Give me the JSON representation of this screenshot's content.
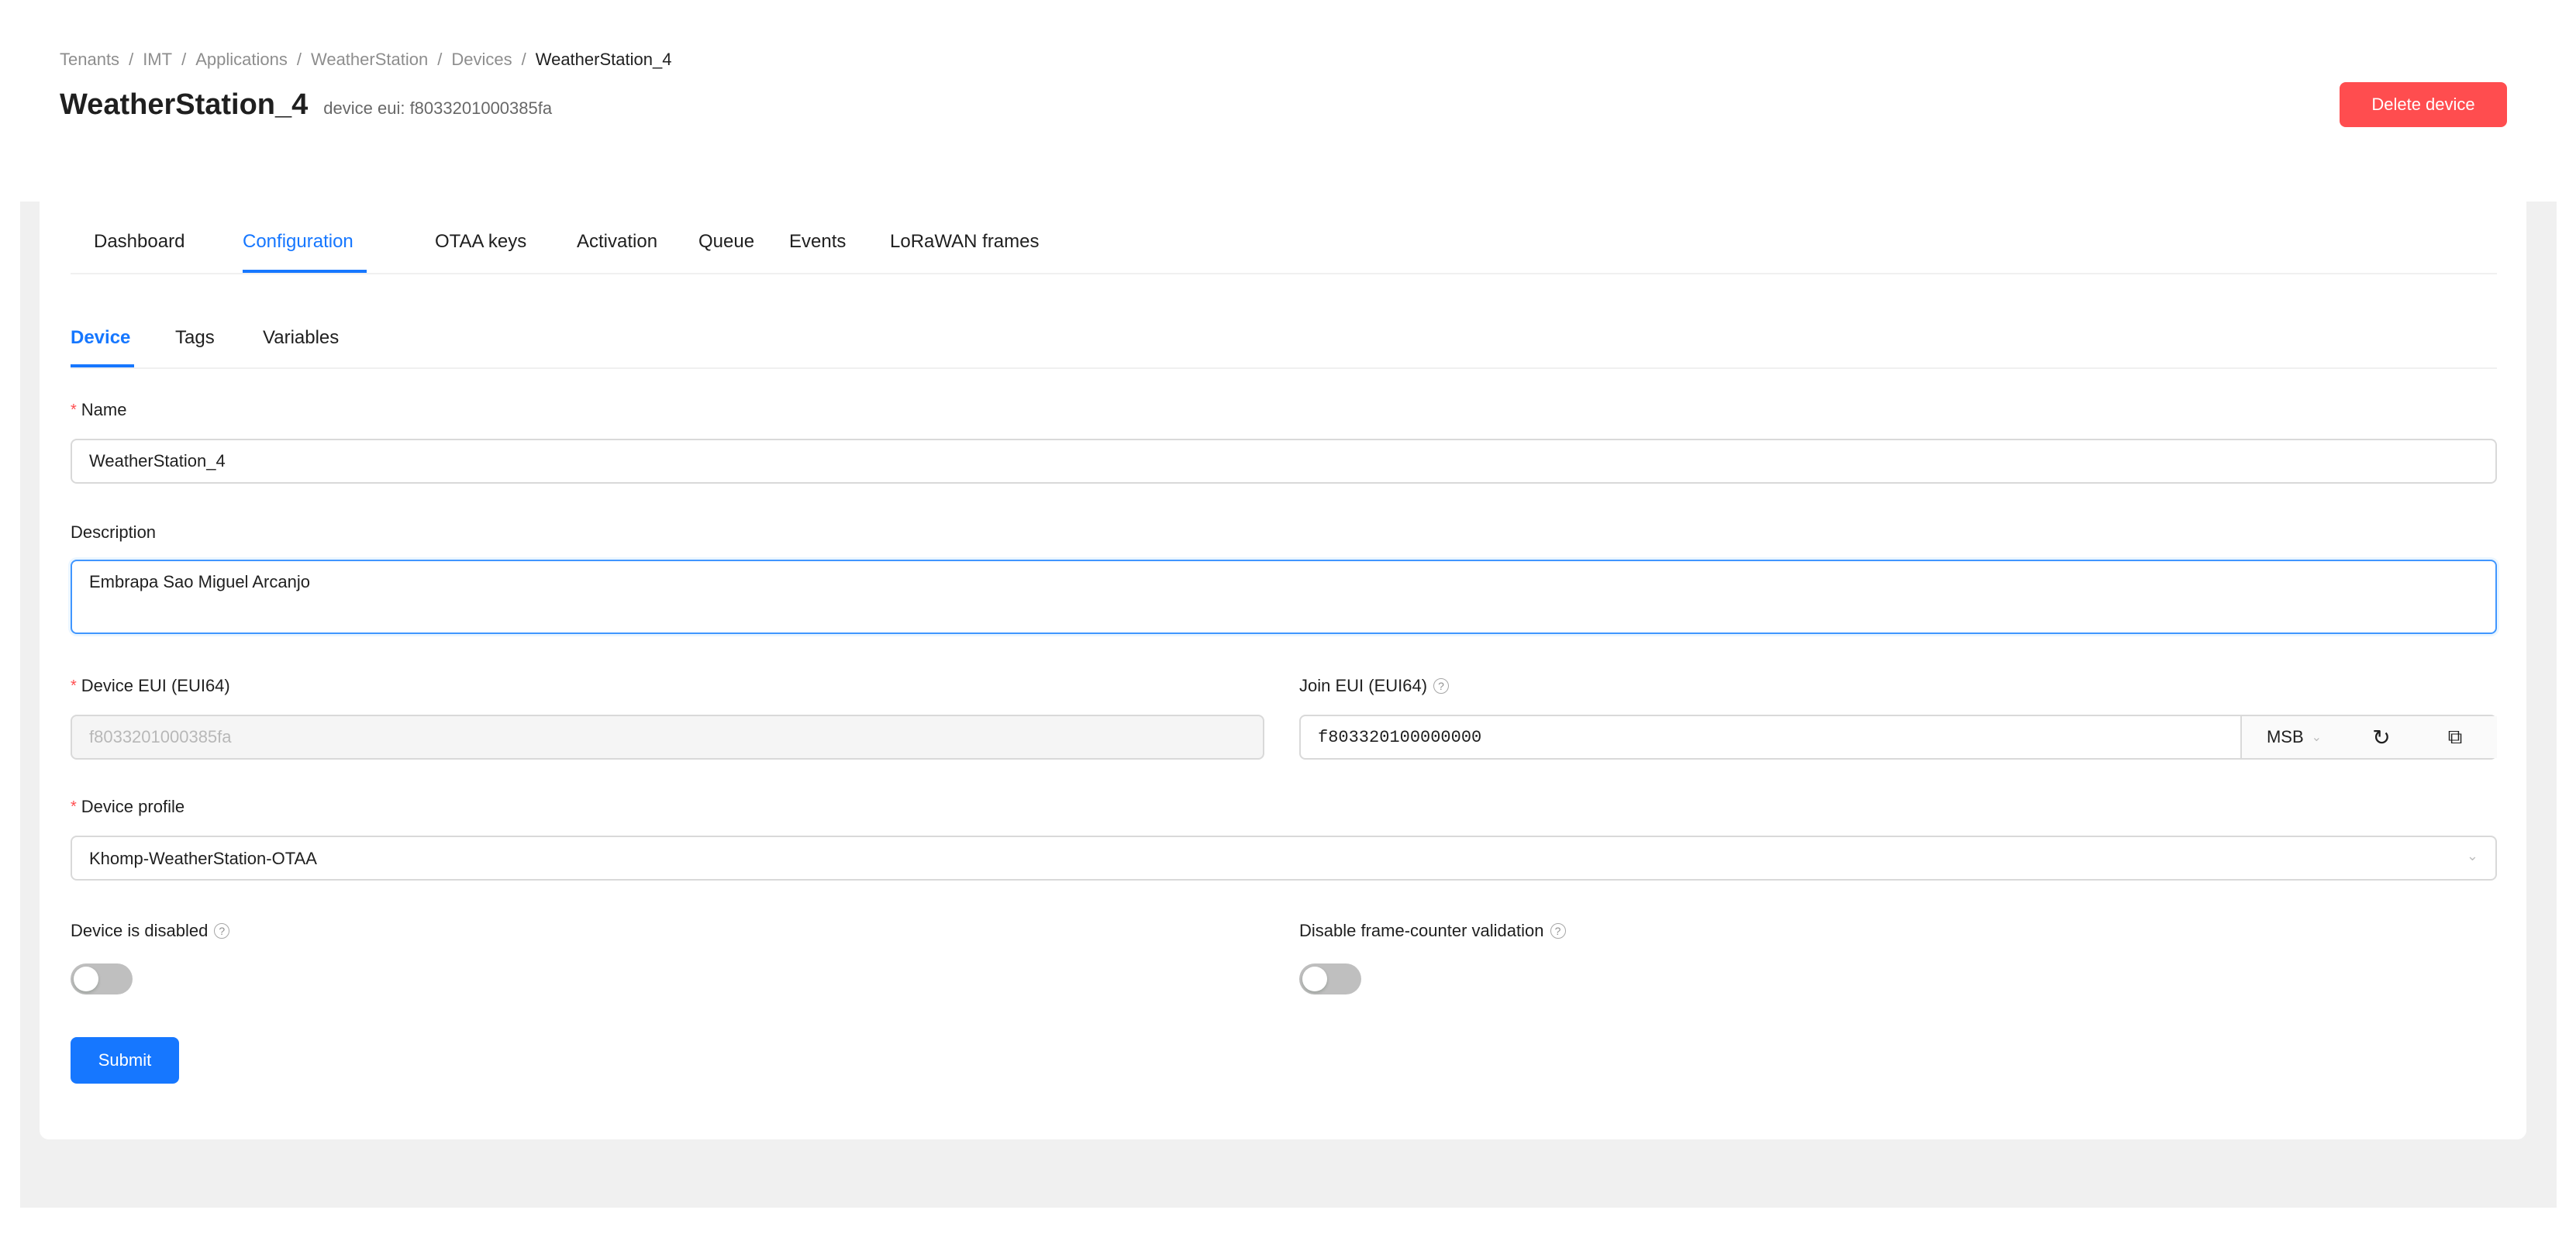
{
  "breadcrumb": [
    "Tenants",
    "IMT",
    "Applications",
    "WeatherStation",
    "Devices",
    "WeatherStation_4"
  ],
  "breadcrumb_separator": "/",
  "header": {
    "title": "WeatherStation_4",
    "subtitle": "device eui: f8033201000385fa",
    "delete_label": "Delete device"
  },
  "tabs": [
    "Dashboard",
    "Configuration",
    "OTAA keys",
    "Activation",
    "Queue",
    "Events",
    "LoRaWAN frames"
  ],
  "active_tab": "Configuration",
  "subtabs": [
    "Device",
    "Tags",
    "Variables"
  ],
  "active_subtab": "Device",
  "form": {
    "required_mark": "*",
    "name": {
      "label": "Name",
      "value": "WeatherStation_4"
    },
    "description": {
      "label": "Description",
      "value": "Embrapa Sao Miguel Arcanjo"
    },
    "dev_eui": {
      "label": "Device EUI (EUI64)",
      "value": "f8033201000385fa"
    },
    "join_eui": {
      "label": "Join EUI (EUI64)",
      "value": "f803320100000000",
      "byte_order": "MSB"
    },
    "device_profile": {
      "label": "Device profile",
      "value": "Khomp-WeatherStation-OTAA"
    },
    "device_disabled": {
      "label": "Device is disabled",
      "checked": false
    },
    "disable_fcnt": {
      "label": "Disable frame-counter validation",
      "checked": false
    },
    "submit_label": "Submit"
  },
  "icons": {
    "help": "?",
    "refresh": "↻",
    "copy": "⧉",
    "chevron": "⌄"
  },
  "colors": {
    "primary": "#1677ff",
    "danger": "#ff4d4f",
    "switch_off": "#bfbfbf"
  }
}
